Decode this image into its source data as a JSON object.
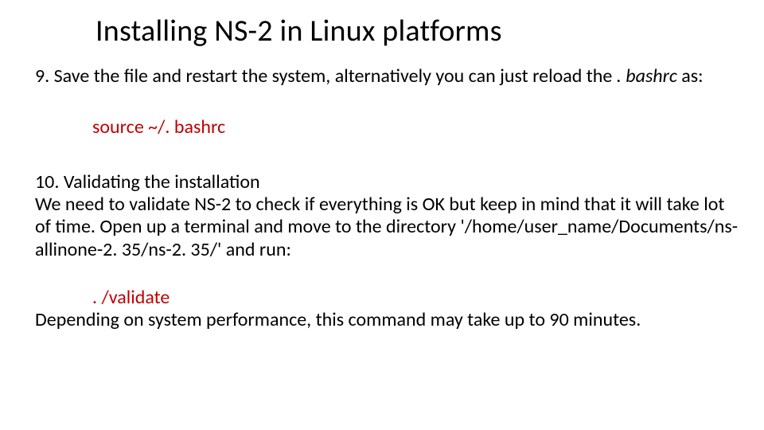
{
  "title": "Installing NS-2 in Linux platforms",
  "step9": {
    "line1": "9. Save the file and restart the system, alternatively you can just reload the",
    "bashrc": ". bashrc",
    "as": " as:",
    "cmd": "source  ~/. bashrc"
  },
  "step10": {
    "heading": "10. Validating the installation",
    "body": "We need to validate NS-2 to check if everything is OK but keep in mind that it will take lot of time. Open up a terminal and move to the directory '/home/user_name/Documents/ns-allinone-2. 35/ns-2. 35/' and run:",
    "cmd": ". /validate",
    "closing": "Depending on system performance, this command may take up to 90 minutes."
  }
}
